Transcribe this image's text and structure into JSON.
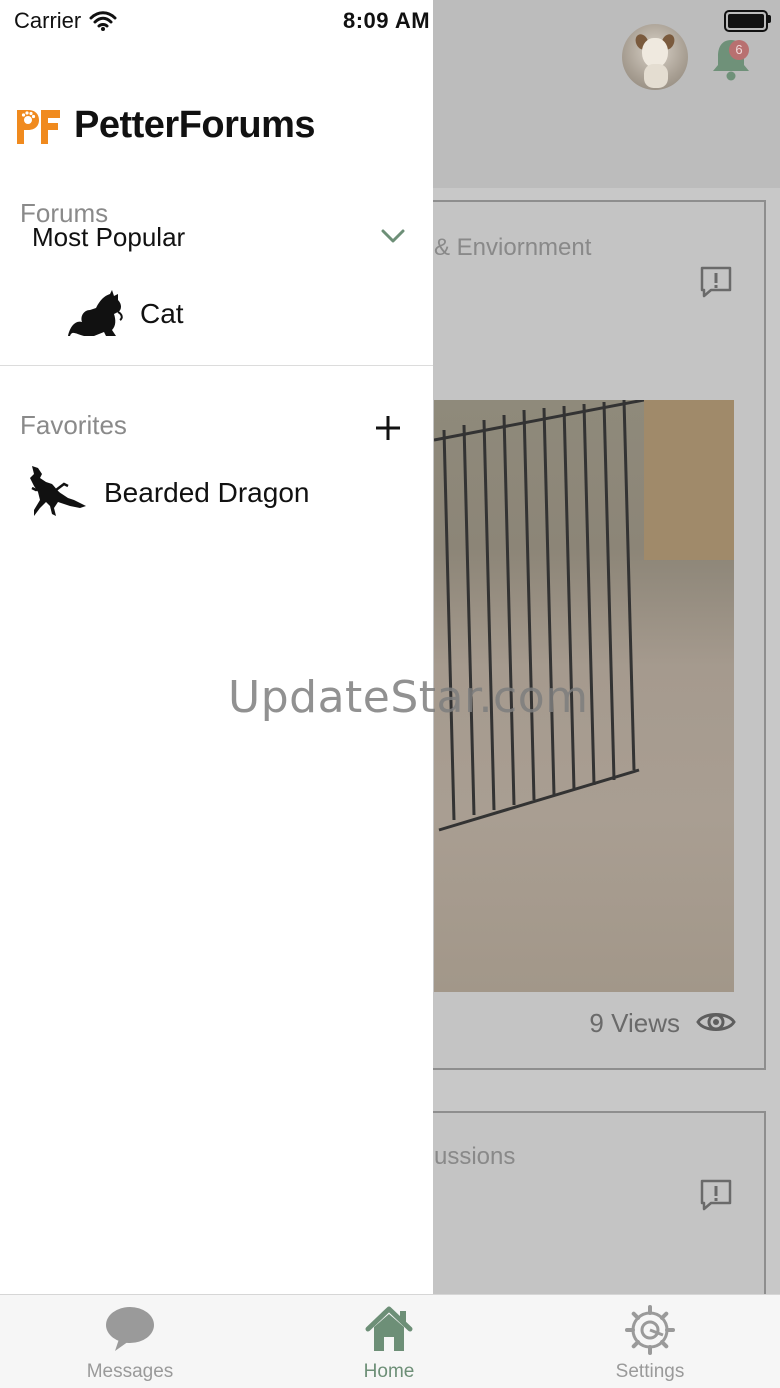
{
  "status_bar": {
    "carrier": "Carrier",
    "time": "8:09 AM"
  },
  "header": {
    "notification_count": "6",
    "avatar_icon": "profile-avatar-dog",
    "bell_icon": "bell-icon",
    "bell_color": "#6d8f77"
  },
  "drawer": {
    "app_name": "PetterForums",
    "logo_mark": "PF",
    "logo_color": "#f08a1e",
    "forums_label": "Forums",
    "forums_selected": "Most Popular",
    "forum_items": [
      {
        "label": "Cat",
        "icon": "cat-icon"
      }
    ],
    "favorites_label": "Favorites",
    "favorite_items": [
      {
        "label": "Bearded Dragon",
        "icon": "bearded-dragon-icon"
      }
    ],
    "accent_color": "#6d8f77"
  },
  "feed": {
    "posts": [
      {
        "category_partial": "& Enviornment",
        "views": "9 Views"
      },
      {
        "category_partial": "ussions"
      }
    ]
  },
  "watermark": "UpdateStar.com",
  "tabbar": {
    "tabs": [
      {
        "label": "Messages",
        "icon": "chat-bubble-icon",
        "active": false
      },
      {
        "label": "Home",
        "icon": "home-icon",
        "active": true
      },
      {
        "label": "Settings",
        "icon": "gear-icon",
        "active": false
      }
    ],
    "active_color": "#6d8f77",
    "inactive_color": "#9a9a9a"
  }
}
